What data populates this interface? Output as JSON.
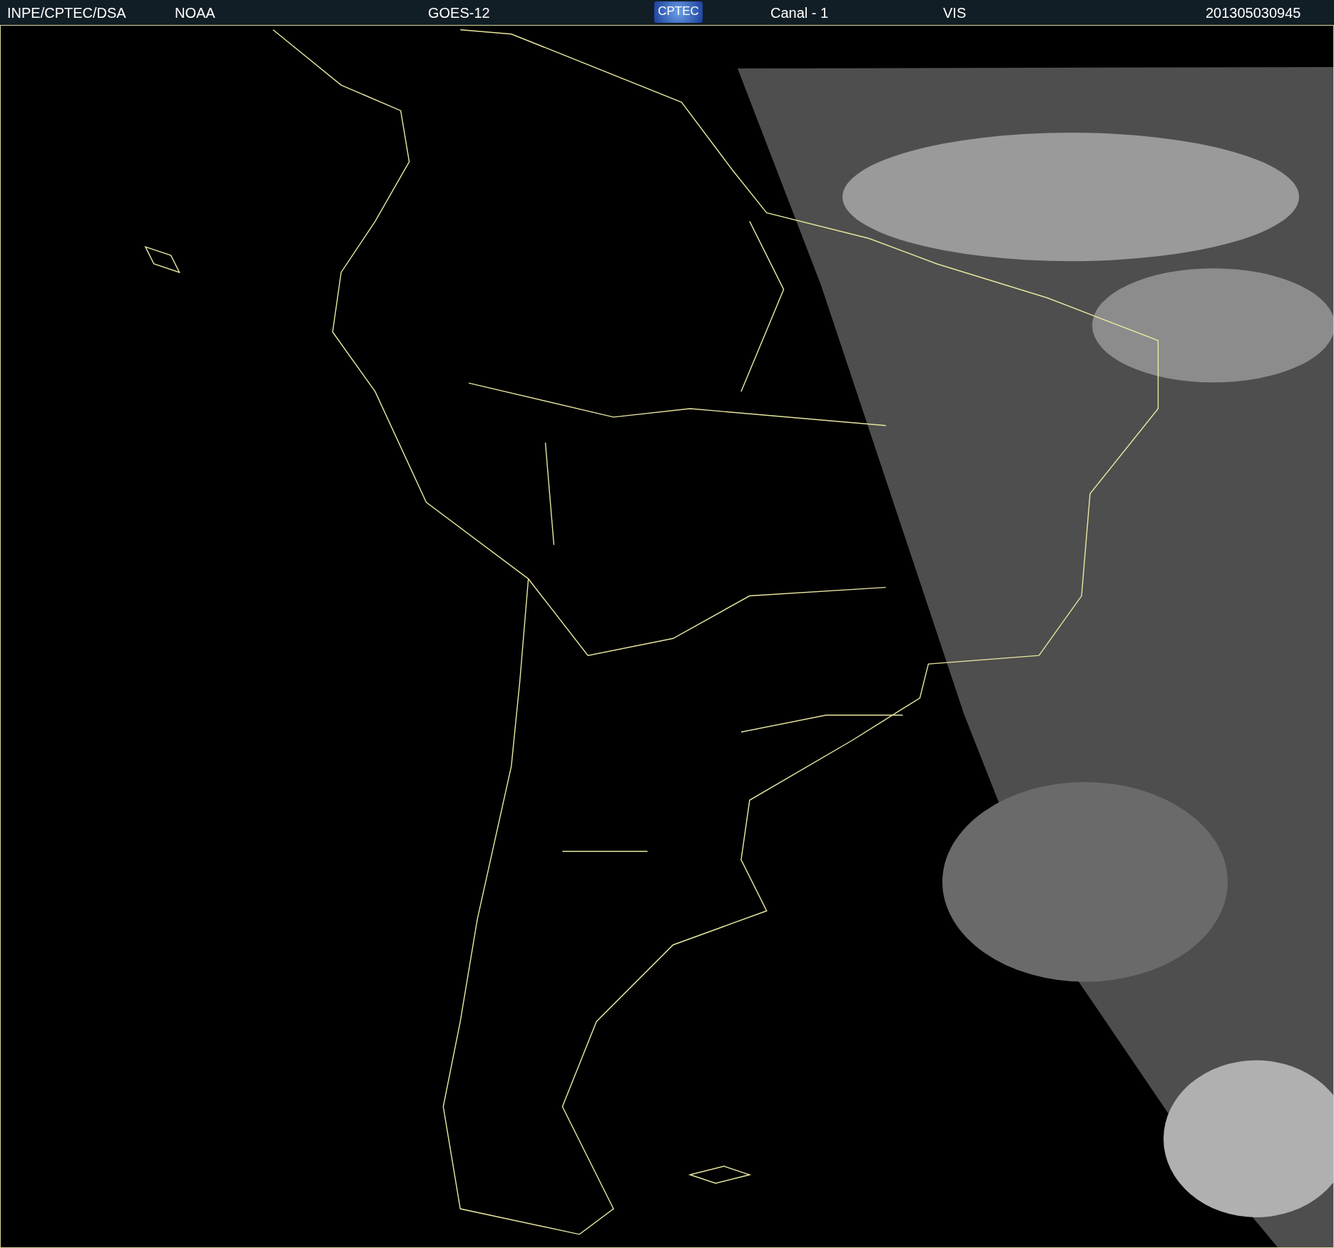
{
  "header": {
    "items": [
      {
        "kind": "text",
        "text": "INPE/CPTEC/DSA"
      },
      {
        "kind": "text",
        "text": "NOAA"
      },
      {
        "kind": "text",
        "text": "GOES-12"
      },
      {
        "kind": "logo",
        "text": "CPTEC"
      },
      {
        "kind": "text",
        "text": "Canal - 1"
      },
      {
        "kind": "text",
        "text": "VIS"
      },
      {
        "kind": "text",
        "text": "201305030945"
      }
    ]
  }
}
